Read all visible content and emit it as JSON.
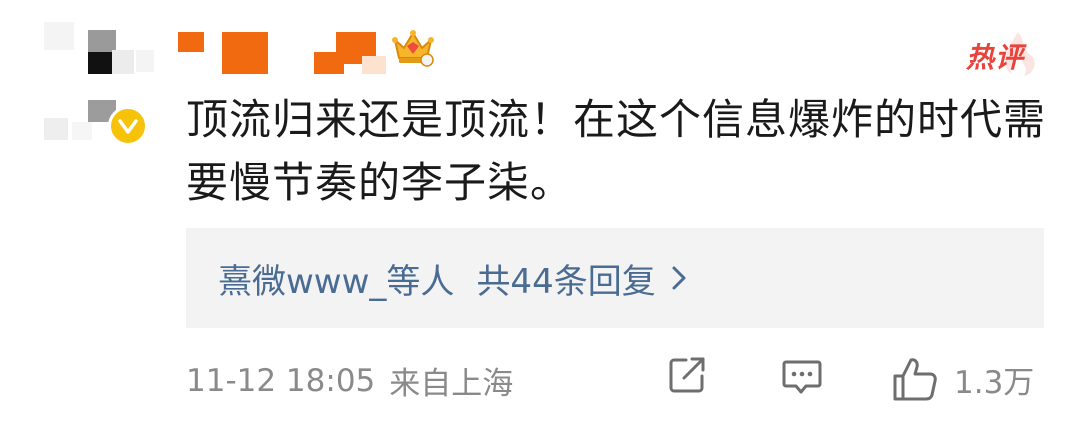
{
  "comment": {
    "hot_tag": "热评",
    "text": "顶流归来还是顶流！在这个信息爆炸的时代需要慢节奏的李子柒。",
    "replies": {
      "users": "熹微www_等人",
      "count": "共44条回复"
    },
    "timestamp": "11-12 18:05",
    "location": "来自上海",
    "likes": "1.3万"
  },
  "colors": {
    "link": "#4a6c93",
    "hot": "#e8443b",
    "meta": "#8a8a8a",
    "reply_bg": "#f3f3f3",
    "mosaic_orange": "#f26a10"
  },
  "icons": {
    "verified": "verified-badge-icon",
    "crown": "crown-icon",
    "share": "share-icon",
    "comment": "comment-icon",
    "like": "thumbs-up-icon",
    "chevron": "chevron-right-icon"
  }
}
